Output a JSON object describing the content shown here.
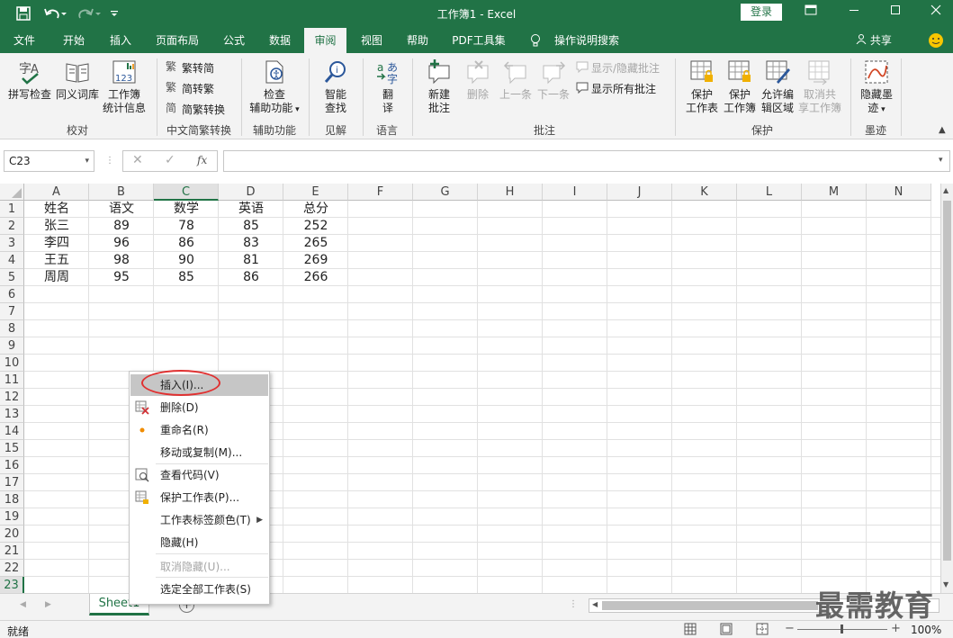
{
  "app": {
    "title": "工作簿1  -  Excel",
    "login_label": "登录",
    "share_label": "共享",
    "smiley_icon": "smiley-icon"
  },
  "tabs": [
    "文件",
    "开始",
    "插入",
    "页面布局",
    "公式",
    "数据",
    "审阅",
    "视图",
    "帮助",
    "PDF工具集",
    "操作说明搜索"
  ],
  "active_tab": "审阅",
  "ribbon": {
    "proofing": {
      "spell_label": "拼写检查",
      "thesaurus_label": "同义词库",
      "stats_label1": "工作簿",
      "stats_label2": "统计信息",
      "group_label": "校对"
    },
    "chinese": {
      "t2s_label": "繁转简",
      "s2t_label": "简转繁",
      "convert_label": "简繁转换",
      "group_label": "中文简繁转换"
    },
    "accessibility": {
      "check_label1": "检查",
      "check_label2": "辅助功能",
      "group_label": "辅助功能"
    },
    "insights": {
      "lookup_label1": "智能",
      "lookup_label2": "查找",
      "group_label": "见解"
    },
    "language": {
      "translate_label1": "翻",
      "translate_label2": "译",
      "group_label": "语言"
    },
    "comments": {
      "new_label1": "新建",
      "new_label2": "批注",
      "delete_label": "删除",
      "prev_label": "上一条",
      "next_label": "下一条",
      "show_hide_label": "显示/隐藏批注",
      "show_all_label": "显示所有批注",
      "group_label": "批注"
    },
    "protect": {
      "sheet_label1": "保护",
      "sheet_label2": "工作表",
      "book_label1": "保护",
      "book_label2": "工作簿",
      "ranges_label1": "允许编",
      "ranges_label2": "辑区域",
      "unshare_label1": "取消共",
      "unshare_label2": "享工作簿",
      "group_label": "保护"
    },
    "ink": {
      "hide_label1": "隐藏墨",
      "hide_label2": "迹",
      "group_label": "墨迹"
    }
  },
  "formula_bar": {
    "name_box": "C23",
    "fx_label": "fx",
    "formula": ""
  },
  "sheet": {
    "columns": [
      "A",
      "B",
      "C",
      "D",
      "E",
      "F",
      "G",
      "H",
      "I",
      "J",
      "K",
      "L",
      "M",
      "N"
    ],
    "selected_column": "C",
    "rows": [
      "1",
      "2",
      "3",
      "4",
      "5",
      "6",
      "7",
      "8",
      "9",
      "10",
      "11",
      "12",
      "13",
      "14",
      "15",
      "16",
      "17",
      "18",
      "19",
      "20",
      "21",
      "22",
      "23"
    ],
    "selected_row": "23",
    "data": [
      [
        "姓名",
        "语文",
        "数学",
        "英语",
        "总分"
      ],
      [
        "张三",
        "89",
        "78",
        "85",
        "252"
      ],
      [
        "李四",
        "96",
        "86",
        "83",
        "265"
      ],
      [
        "王五",
        "98",
        "90",
        "81",
        "269"
      ],
      [
        "周周",
        "95",
        "85",
        "86",
        "266"
      ]
    ]
  },
  "context_menu": {
    "items": [
      {
        "label": "插入(I)...",
        "icon": "",
        "enabled": true,
        "highlighted": true
      },
      {
        "label": "删除(D)",
        "icon": "delete-sheet-icon",
        "enabled": true
      },
      {
        "label": "重命名(R)",
        "icon": "bullet-icon",
        "enabled": true
      },
      {
        "label": "移动或复制(M)...",
        "icon": "",
        "enabled": true
      },
      {
        "label": "查看代码(V)",
        "icon": "view-code-icon",
        "enabled": true
      },
      {
        "label": "保护工作表(P)...",
        "icon": "protect-sheet-icon",
        "enabled": true
      },
      {
        "label": "工作表标签颜色(T)",
        "icon": "",
        "enabled": true,
        "submenu": true
      },
      {
        "label": "隐藏(H)",
        "icon": "",
        "enabled": true
      },
      {
        "label": "取消隐藏(U)...",
        "icon": "",
        "enabled": false
      },
      {
        "label": "选定全部工作表(S)",
        "icon": "",
        "enabled": true
      }
    ]
  },
  "sheet_tabs": {
    "active": "Sheet1",
    "add_icon": "add-sheet-icon"
  },
  "status": {
    "ready": "就绪",
    "zoom": "100%"
  },
  "watermark": "最需教育",
  "colors": {
    "accent": "#217346",
    "highlight_oval": "#e03131"
  }
}
